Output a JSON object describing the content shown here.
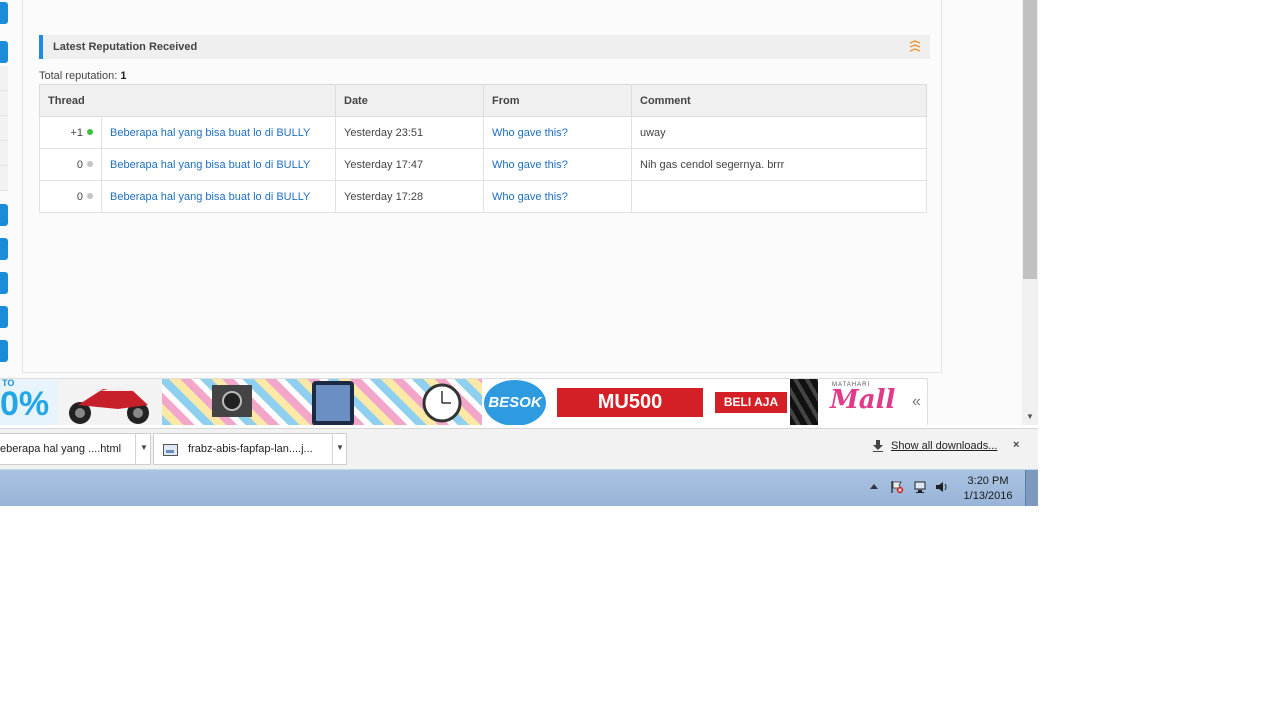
{
  "section": {
    "title": "Latest Reputation Received",
    "icon": "collapse-icon",
    "total_label": "Total reputation:",
    "total_value": "1"
  },
  "table": {
    "headers": [
      "Thread",
      "Date",
      "From",
      "Comment"
    ],
    "rows": [
      {
        "points": "+1",
        "status_color": "#3cc13c",
        "thread": "Beberapa hal yang bisa buat lo di BULLY",
        "date": "Yesterday 23:51",
        "from": "Who gave this?",
        "comment": "uway"
      },
      {
        "points": "0",
        "status_color": "#c4c4c4",
        "thread": "Beberapa hal yang bisa buat lo di BULLY",
        "date": "Yesterday 17:47",
        "from": "Who gave this?",
        "comment": "Nih gas cendol segernya. brrr"
      },
      {
        "points": "0",
        "status_color": "#c4c4c4",
        "thread": "Beberapa hal yang bisa buat lo di BULLY",
        "date": "Yesterday 17:28",
        "from": "Who gave this?",
        "comment": ""
      }
    ]
  },
  "ad": {
    "percent": "0%",
    "percent_prefix": "TO",
    "besok": "BESOK",
    "code": "MU500",
    "cta": "BELI AJA",
    "brand_top": "MATAHARI",
    "brand": "Mall",
    "collapse": "«"
  },
  "downloads": {
    "items": [
      {
        "name": "eberapa hal yang ....html"
      },
      {
        "name": "frabz-abis-fapfap-lan....j..."
      }
    ],
    "show_all": "Show all downloads...",
    "close": "×"
  },
  "taskbar": {
    "time": "3:20 PM",
    "date": "1/13/2016"
  },
  "colors": {
    "accent": "#1e88e5",
    "link": "#1e6fc2",
    "positive": "#3cc13c",
    "neutral": "#c4c4c4",
    "ad_red": "#d51f27"
  }
}
